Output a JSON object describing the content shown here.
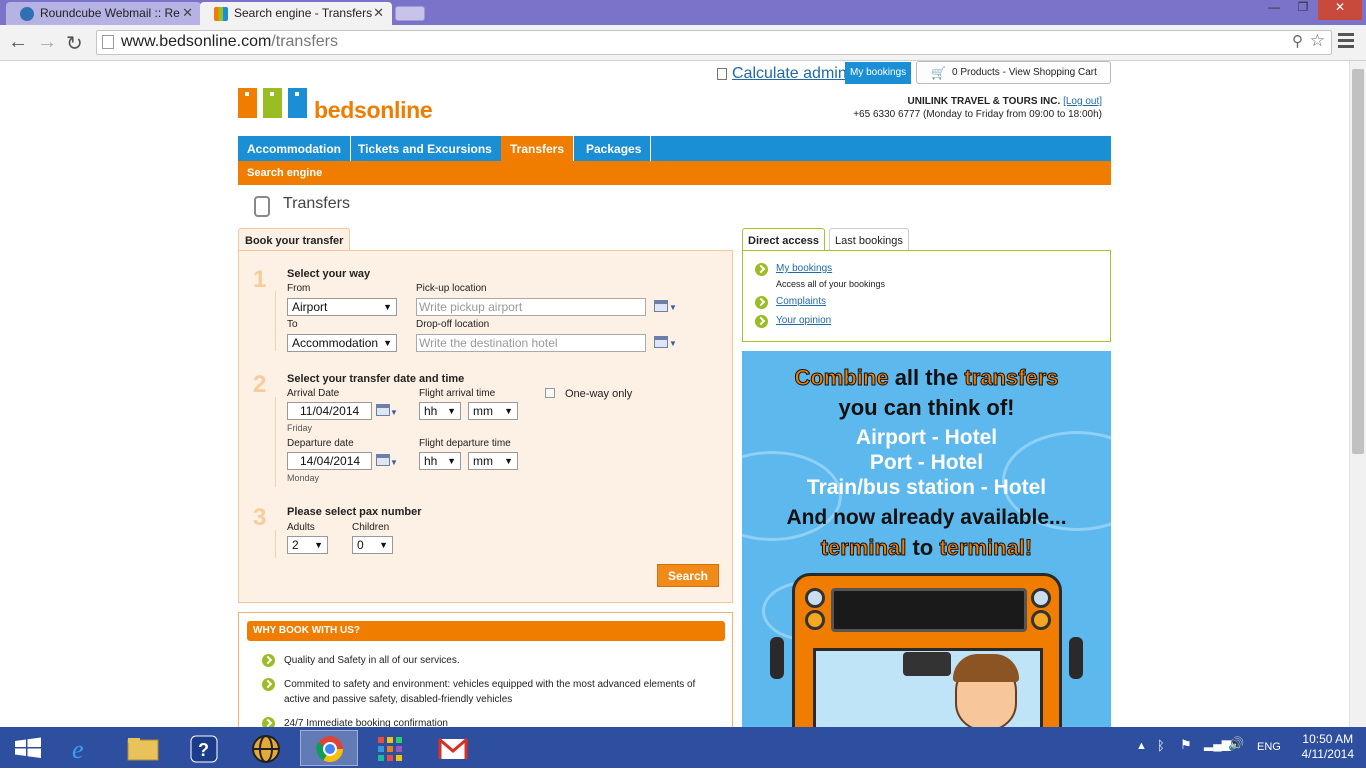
{
  "browser": {
    "tabs": [
      {
        "title": "Roundcube Webmail :: Re",
        "favicon_color": "#2f6fb4"
      },
      {
        "title": "Search engine - Transfers",
        "favicon_color": "#f07d00"
      }
    ],
    "url_host": "www.bedsonline.com",
    "url_path": "/transfers",
    "icons": [
      "back-icon",
      "forward-icon",
      "reload-icon",
      "zoom-icon",
      "star-icon",
      "menu-icon"
    ]
  },
  "header": {
    "calc_label": "Calculate admin fees",
    "mybookings_label": "My bookings",
    "cart_label": "0 Products - View Shopping Cart",
    "logo_text": "bedsonline",
    "agency_name": "UNILINK TRAVEL & TOURS INC.",
    "logout_label": "[Log out]",
    "agency_phone": "+65 6330 6777 (Monday to Friday from 09:00 to 18:00h)",
    "brand_colors": {
      "orange": "#f07d00",
      "green": "#9bbd24",
      "blue": "#1a8fd6"
    }
  },
  "nav": {
    "items": [
      "Accommodation",
      "Tickets and Excursions",
      "Transfers",
      "Packages"
    ],
    "active": "Transfers",
    "subnav": "Search engine"
  },
  "page_title": "Transfers",
  "form": {
    "tab_label": "Book your transfer",
    "step1": {
      "num": "1",
      "title": "Select your way",
      "from_label": "From",
      "from_value": "Airport",
      "to_label": "To",
      "to_value": "Accommodation",
      "pickup_label": "Pick-up location",
      "pickup_placeholder": "Write pickup airport",
      "dropoff_label": "Drop-off location",
      "dropoff_placeholder": "Write the destination hotel"
    },
    "step2": {
      "num": "2",
      "title": "Select your transfer date and time",
      "arrival_label": "Arrival Date",
      "arrival_value": "11/04/2014",
      "arrival_day": "Friday",
      "flight_arrival_label": "Flight arrival time",
      "departure_label": "Departure date",
      "departure_value": "14/04/2014",
      "departure_day": "Monday",
      "flight_departure_label": "Flight departure time",
      "hh": "hh",
      "mm": "mm",
      "oneway_label": "One-way only",
      "oneway_checked": false
    },
    "step3": {
      "num": "3",
      "title": "Please select pax number",
      "adults_label": "Adults",
      "adults_value": "2",
      "children_label": "Children",
      "children_value": "0"
    },
    "search_label": "Search"
  },
  "why": {
    "title": "WHY BOOK WITH US?",
    "items": [
      "Quality and Safety in all of our services.",
      "Commited to safety and environment: vehicles equipped with the most advanced elements of active and passive safety, disabled-friendly vehicles",
      "24/7 Immediate booking confirmation"
    ]
  },
  "right": {
    "tabs": [
      "Direct access",
      "Last bookings"
    ],
    "links": [
      {
        "label": "My bookings",
        "desc": "Access all of your bookings"
      },
      {
        "label": "Complaints",
        "desc": ""
      },
      {
        "label": "Your opinion",
        "desc": ""
      }
    ]
  },
  "promo": {
    "line1_a": "Combine",
    "line1_b": " all the ",
    "line1_c": "transfers",
    "line2": "you can think of!",
    "line3": "Airport - Hotel",
    "line4": "Port - Hotel",
    "line5": "Train/bus station - Hotel",
    "line6": "And now already available...",
    "line7_a": "terminal",
    "line7_b": " to ",
    "line7_c": "terminal!"
  },
  "taskbar": {
    "apps": [
      "windows-start-icon",
      "ie-icon",
      "file-explorer-icon",
      "help-icon",
      "globe-icon",
      "chrome-icon",
      "apps-icon",
      "gmail-icon"
    ],
    "lang": "ENG",
    "time": "10:50 AM",
    "date": "4/11/2014"
  }
}
